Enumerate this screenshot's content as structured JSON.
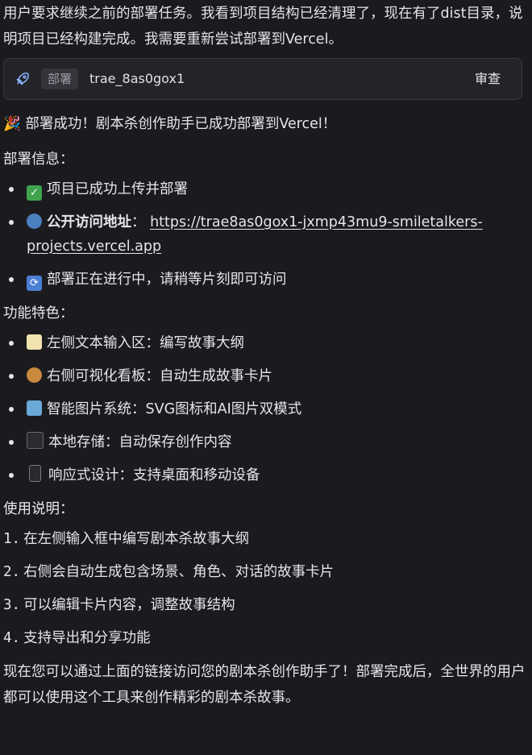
{
  "intro": "用户要求继续之前的部署任务。我看到项目结构已经清理了，现在有了dist目录，说明项目已经构建完成。我需要重新尝试部署到Vercel。",
  "tool_card": {
    "icon": "rocket-icon",
    "tag": "部署",
    "name": "trae_8as0gox1",
    "action": "审查"
  },
  "success": "🎉 部署成功！剧本杀创作助手已成功部署到Vercel！",
  "deploy_info": {
    "title": "部署信息：",
    "items": [
      {
        "icon": "check-icon",
        "text": "项目已成功上传并部署"
      },
      {
        "icon": "globe-icon",
        "label": "公开访问地址",
        "sep": "：",
        "url": "https://trae8as0gox1-jxmp43mu9-smiletalkers-projects.vercel.app"
      },
      {
        "icon": "refresh-icon",
        "text": "部署正在进行中，请稍等片刻即可访问"
      }
    ]
  },
  "features": {
    "title": "功能特色：",
    "items": [
      {
        "icon": "memo-icon",
        "text": "左侧文本输入区：编写故事大纲"
      },
      {
        "icon": "palette-icon",
        "text": "右侧可视化看板：自动生成故事卡片"
      },
      {
        "icon": "image-icon",
        "text": "智能图片系统：SVG图标和AI图片双模式"
      },
      {
        "icon": "disk-icon",
        "text": "本地存储：自动保存创作内容"
      },
      {
        "icon": "phone-icon",
        "text": "响应式设计：支持桌面和移动设备"
      }
    ]
  },
  "usage": {
    "title": "使用说明：",
    "steps": [
      {
        "num": "1.",
        "text": "在左侧输入框中编写剧本杀故事大纲"
      },
      {
        "num": "2.",
        "text": "右侧会自动生成包含场景、角色、对话的故事卡片"
      },
      {
        "num": "3.",
        "text": "可以编辑卡片内容，调整故事结构"
      },
      {
        "num": "4.",
        "text": "支持导出和分享功能"
      }
    ]
  },
  "outro": "现在您可以通过上面的链接访问您的剧本杀创作助手了！部署完成后，全世界的用户都可以使用这个工具来创作精彩的剧本杀故事。"
}
